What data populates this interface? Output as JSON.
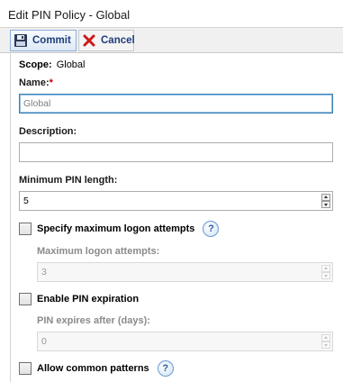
{
  "window": {
    "title": "Edit PIN Policy - Global"
  },
  "toolbar": {
    "commit_label": "Commit",
    "cancel_label": "Cancel"
  },
  "scope": {
    "label": "Scope:",
    "value": "Global"
  },
  "name": {
    "label": "Name:",
    "required_marker": "*",
    "value": "Global"
  },
  "description": {
    "label": "Description:",
    "value": ""
  },
  "min_pin_length": {
    "label": "Minimum PIN length:",
    "value": "5"
  },
  "max_logon": {
    "checkbox_label": "Specify maximum logon attempts",
    "checked": false,
    "sub_label": "Maximum logon attempts:",
    "value": "3"
  },
  "pin_expiration": {
    "checkbox_label": "Enable PIN expiration",
    "checked": false,
    "sub_label": "PIN expires after (days):",
    "value": "0"
  },
  "common_patterns": {
    "checkbox_label": "Allow common patterns",
    "checked": false
  },
  "help_glyph": "?"
}
